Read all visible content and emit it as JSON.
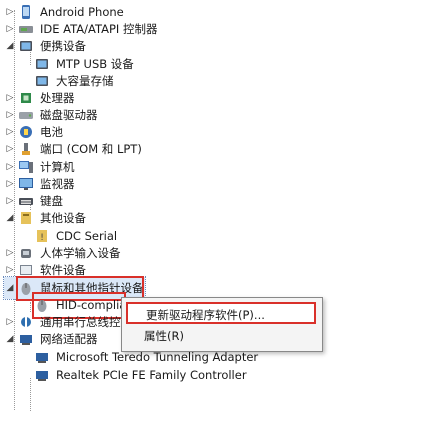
{
  "device_tree": {
    "items": [
      {
        "label": "Android Phone",
        "icon": "phone-device-icon",
        "expander": "▷"
      },
      {
        "label": "IDE ATA/ATAPI 控制器",
        "icon": "ide-controller-icon",
        "expander": "▷"
      },
      {
        "label": "便携设备",
        "icon": "portable-device-icon",
        "expander": "◢"
      },
      {
        "label": "MTP USB 设备",
        "icon": "mtp-device-icon",
        "expander": ""
      },
      {
        "label": "大容量存储",
        "icon": "storage-device-icon",
        "expander": ""
      },
      {
        "label": "处理器",
        "icon": "processor-icon",
        "expander": "▷"
      },
      {
        "label": "磁盘驱动器",
        "icon": "disk-drive-icon",
        "expander": "▷"
      },
      {
        "label": "电池",
        "icon": "battery-icon",
        "expander": "▷"
      },
      {
        "label": "端口 (COM 和 LPT)",
        "icon": "port-icon",
        "expander": "▷"
      },
      {
        "label": "计算机",
        "icon": "computer-icon",
        "expander": "▷"
      },
      {
        "label": "监视器",
        "icon": "monitor-icon",
        "expander": "▷"
      },
      {
        "label": "键盘",
        "icon": "keyboard-icon",
        "expander": "▷"
      },
      {
        "label": "其他设备",
        "icon": "other-devices-icon",
        "expander": "◢"
      },
      {
        "label": "CDC Serial",
        "icon": "unknown-device-icon",
        "expander": ""
      },
      {
        "label": "人体学输入设备",
        "icon": "hid-icon",
        "expander": "▷"
      },
      {
        "label": "软件设备",
        "icon": "software-device-icon",
        "expander": "▷"
      },
      {
        "label": "鼠标和其他指针设备",
        "icon": "mouse-icon",
        "expander": "◢"
      },
      {
        "label": "HID-compliant",
        "icon": "mouse-device-icon",
        "expander": ""
      },
      {
        "label": "通用串行总线控制器",
        "icon": "usb-controller-icon",
        "expander": "▷"
      },
      {
        "label": "网络适配器",
        "icon": "network-adapter-icon",
        "expander": "◢"
      },
      {
        "label": "Microsoft Teredo Tunneling Adapter",
        "icon": "network-card-icon",
        "expander": ""
      },
      {
        "label": "Realtek PCIe FE Family Controller",
        "icon": "network-card-icon",
        "expander": ""
      }
    ]
  },
  "context_menu": {
    "items": [
      {
        "label": "更新驱动程序软件(P)..."
      },
      {
        "label": "属性(R)"
      }
    ]
  },
  "colors": {
    "highlight_red": "#d9302a",
    "selection_blue": "#dbe8f8"
  }
}
